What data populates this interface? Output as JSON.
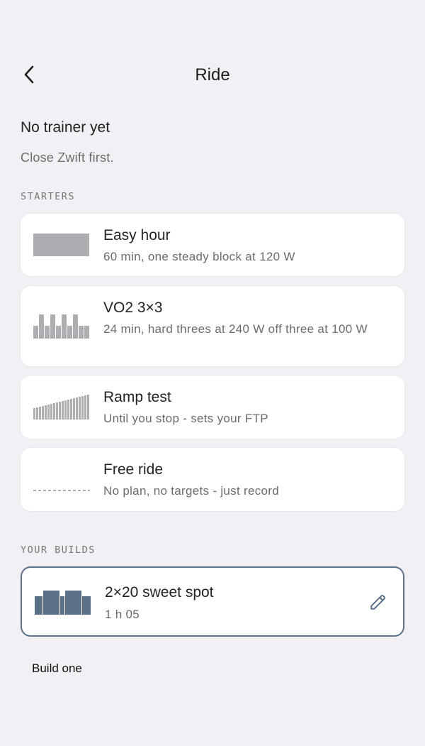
{
  "header": {
    "title": "Ride",
    "back_icon": "chevron-left-icon"
  },
  "status": {
    "title": "No trainer yet",
    "subtitle": "Close Zwift first."
  },
  "starters": {
    "label": "STARTERS",
    "items": [
      {
        "name": "Easy hour",
        "desc": "60 min, one steady block at 120 W",
        "thumb": "steady-block-icon"
      },
      {
        "name": "VO2 3×3",
        "desc": "24 min, hard threes at 240 W off three at 100 W",
        "thumb": "intervals-icon"
      },
      {
        "name": "Ramp test",
        "desc": "Until you stop - sets your FTP",
        "thumb": "ramp-icon"
      },
      {
        "name": "Free ride",
        "desc": "No plan, no targets - just record",
        "thumb": "dashed-line-icon"
      }
    ]
  },
  "builds": {
    "label": "YOUR BUILDS",
    "items": [
      {
        "name": "2×20 sweet spot",
        "desc": "1 h 05",
        "thumb": "blocks-icon",
        "edit_icon": "pencil-icon"
      }
    ],
    "build_one_label": "Build one"
  },
  "colors": {
    "background": "#f1f0f5",
    "card": "#ffffff",
    "thumb_gray": "#adadb2",
    "build_accent": "#5a7189"
  }
}
